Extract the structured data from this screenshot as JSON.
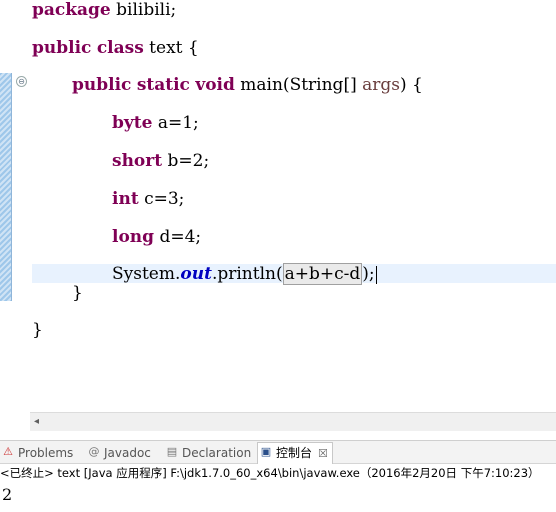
{
  "code": {
    "line1": {
      "kw": "package",
      "rest": " bilibili;"
    },
    "line2": {
      "kw1": "public",
      "kw2": "class",
      "rest": " text {"
    },
    "line3": {
      "kw1": "public",
      "kw2": "static",
      "kw3": "void",
      "name": " main(String[] ",
      "param": "args",
      "rest": ") {"
    },
    "line4": {
      "kw": "byte",
      "rest": " a=1;"
    },
    "line5": {
      "kw": "short",
      "rest": " b=2;"
    },
    "line6": {
      "kw": "int",
      "rest": " c=3;"
    },
    "line7": {
      "kw": "long",
      "rest": " d=4;"
    },
    "line8": {
      "pre": "System.",
      "field": "out",
      "mid": ".println(",
      "sel": "a+b+c-d",
      "post": ");"
    },
    "line9": "}",
    "line10": "}"
  },
  "tabs": {
    "problems": "Problems",
    "javadoc": "Javadoc",
    "declaration": "Declaration",
    "console": "控制台",
    "console_close": "☒"
  },
  "icons": {
    "problems": "problems-icon",
    "javadoc": "javadoc-icon",
    "declaration": "declaration-icon",
    "console": "console-icon"
  },
  "console": {
    "header": "<已终止> text [Java 应用程序] F:\\jdk1.7.0_60_x64\\bin\\javaw.exe（2016年2月20日 下午7:10:23）",
    "output": "2"
  },
  "colors": {
    "keyword": "#7f0055",
    "field": "#0000c0",
    "current_line": "#e8f2fe"
  }
}
